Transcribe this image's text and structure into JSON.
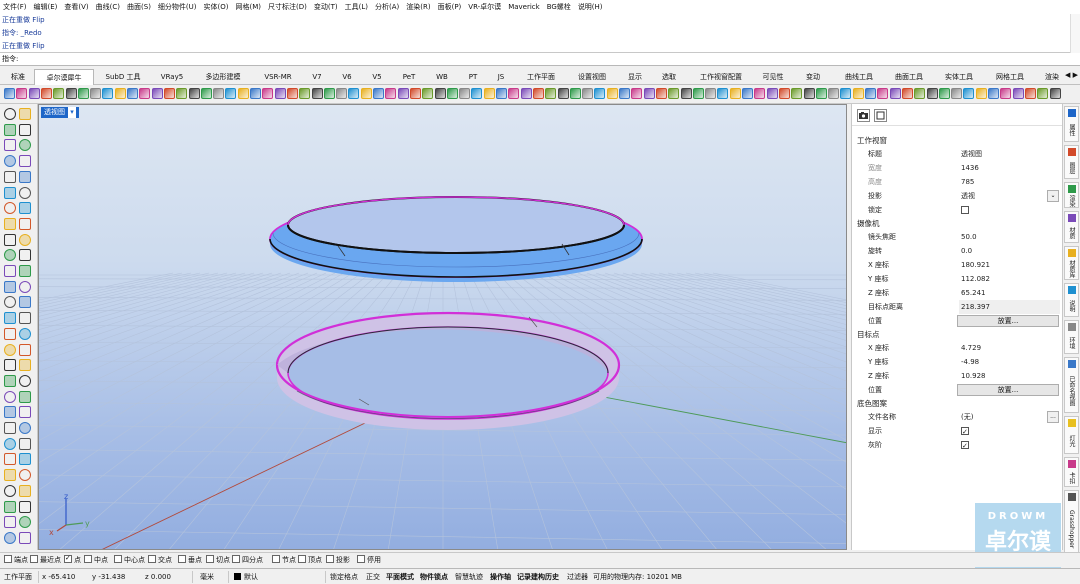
{
  "menu": [
    "文件(F)",
    "编辑(E)",
    "查看(V)",
    "曲线(C)",
    "曲面(S)",
    "细分物件(U)",
    "实体(O)",
    "网格(M)",
    "尺寸标注(D)",
    "变动(T)",
    "工具(L)",
    "分析(A)",
    "渲染(R)",
    "面板(P)",
    "VR-卓尔谟",
    "Maverick",
    "BG螺栓",
    "说明(H)"
  ],
  "command_history": [
    "正在重做 Flip",
    "指令: _Redo",
    "正在重做 Flip"
  ],
  "command_prompt": "指令:",
  "tabs": [
    "标准",
    "卓尔谟犀牛",
    "SubD 工具",
    "VRay5",
    "多边形建模",
    "VSR-MR",
    "V7",
    "V6",
    "V5",
    "PeT",
    "WB",
    "PT",
    "JS",
    "工作平面",
    "设置视图",
    "显示",
    "选取",
    "工作视窗配置",
    "可见性",
    "变动",
    "曲线工具",
    "曲面工具",
    "实体工具",
    "网格工具",
    "渲染"
  ],
  "active_tab": "卓尔谟犀牛",
  "viewport": {
    "title": "透视图",
    "axis_x": "x",
    "axis_y": "y",
    "axis_z": "z"
  },
  "properties": {
    "section_viewport": "工作视窗",
    "title_label": "标题",
    "title_value": "透视图",
    "width_label": "宽度",
    "width_value": "1436",
    "height_label": "高度",
    "height_value": "785",
    "projection_label": "投影",
    "projection_value": "透视",
    "locked_label": "锁定",
    "locked": false,
    "section_camera": "摄像机",
    "lens_label": "镜头焦距",
    "lens_value": "50.0",
    "rotation_label": "旋转",
    "rotation_value": "0.0",
    "cam_x_label": "X 座标",
    "cam_x_value": "180.921",
    "cam_y_label": "Y 座标",
    "cam_y_value": "112.082",
    "cam_z_label": "Z 座标",
    "cam_z_value": "65.241",
    "target_dist_label": "目标点距离",
    "target_dist_value": "218.397",
    "position_label": "位置",
    "place_button": "放置...",
    "section_target": "目标点",
    "tgt_x_label": "X 座标",
    "tgt_x_value": "4.729",
    "tgt_y_label": "Y 座标",
    "tgt_y_value": "-4.98",
    "tgt_z_label": "Z 座标",
    "tgt_z_value": "10.928",
    "tgt_position_label": "位置",
    "tgt_place_button": "放置...",
    "section_wallpaper": "底色图案",
    "filename_label": "文件名称",
    "filename_value": "(无)",
    "filename_button": "...",
    "show_label": "显示",
    "show_checked": true,
    "gray_label": "灰阶",
    "gray_checked": true
  },
  "side_tabs": [
    "属性",
    "图层",
    "渲染",
    "材质",
    "材质库",
    "说明",
    "环境",
    "已命名视图",
    "灯光",
    "卡扣",
    "Grasshopper"
  ],
  "watermark": {
    "line1": "DROWM",
    "line2": "卓尔谟"
  },
  "osnaps": [
    {
      "label": "端点",
      "checked": false
    },
    {
      "label": "最近点",
      "checked": false
    },
    {
      "label": "点",
      "checked": true
    },
    {
      "label": "中点",
      "checked": false
    },
    {
      "label": "中心点",
      "checked": false
    },
    {
      "label": "交点",
      "checked": false
    },
    {
      "label": "垂点",
      "checked": false
    },
    {
      "label": "切点",
      "checked": false
    },
    {
      "label": "四分点",
      "checked": false
    },
    {
      "label": "节点",
      "checked": false
    },
    {
      "label": "顶点",
      "checked": false
    },
    {
      "label": "投影",
      "checked": false
    },
    {
      "label": "停用",
      "checked": false
    }
  ],
  "status": {
    "cplane": "工作平面",
    "x": "x -65.410",
    "y": "y -31.438",
    "z": "z 0.000",
    "units": "毫米",
    "layer": "默认",
    "items": [
      "锁定格点",
      "正交",
      "平面模式",
      "物件锁点",
      "智慧轨迹",
      "操作轴",
      "记录建构历史",
      "过滤器"
    ],
    "memory": "可用的物理内存: 10201 MB"
  },
  "colors": {
    "ring_blue": "#6aa7f0",
    "ring_magenta": "#d12fd8",
    "ring_inner": "#b6a8d8",
    "x_axis": "#b24a3c",
    "y_axis": "#4e9a58",
    "z_axis": "#2f56c8",
    "viewport_title_bg": "#1e66c8"
  }
}
